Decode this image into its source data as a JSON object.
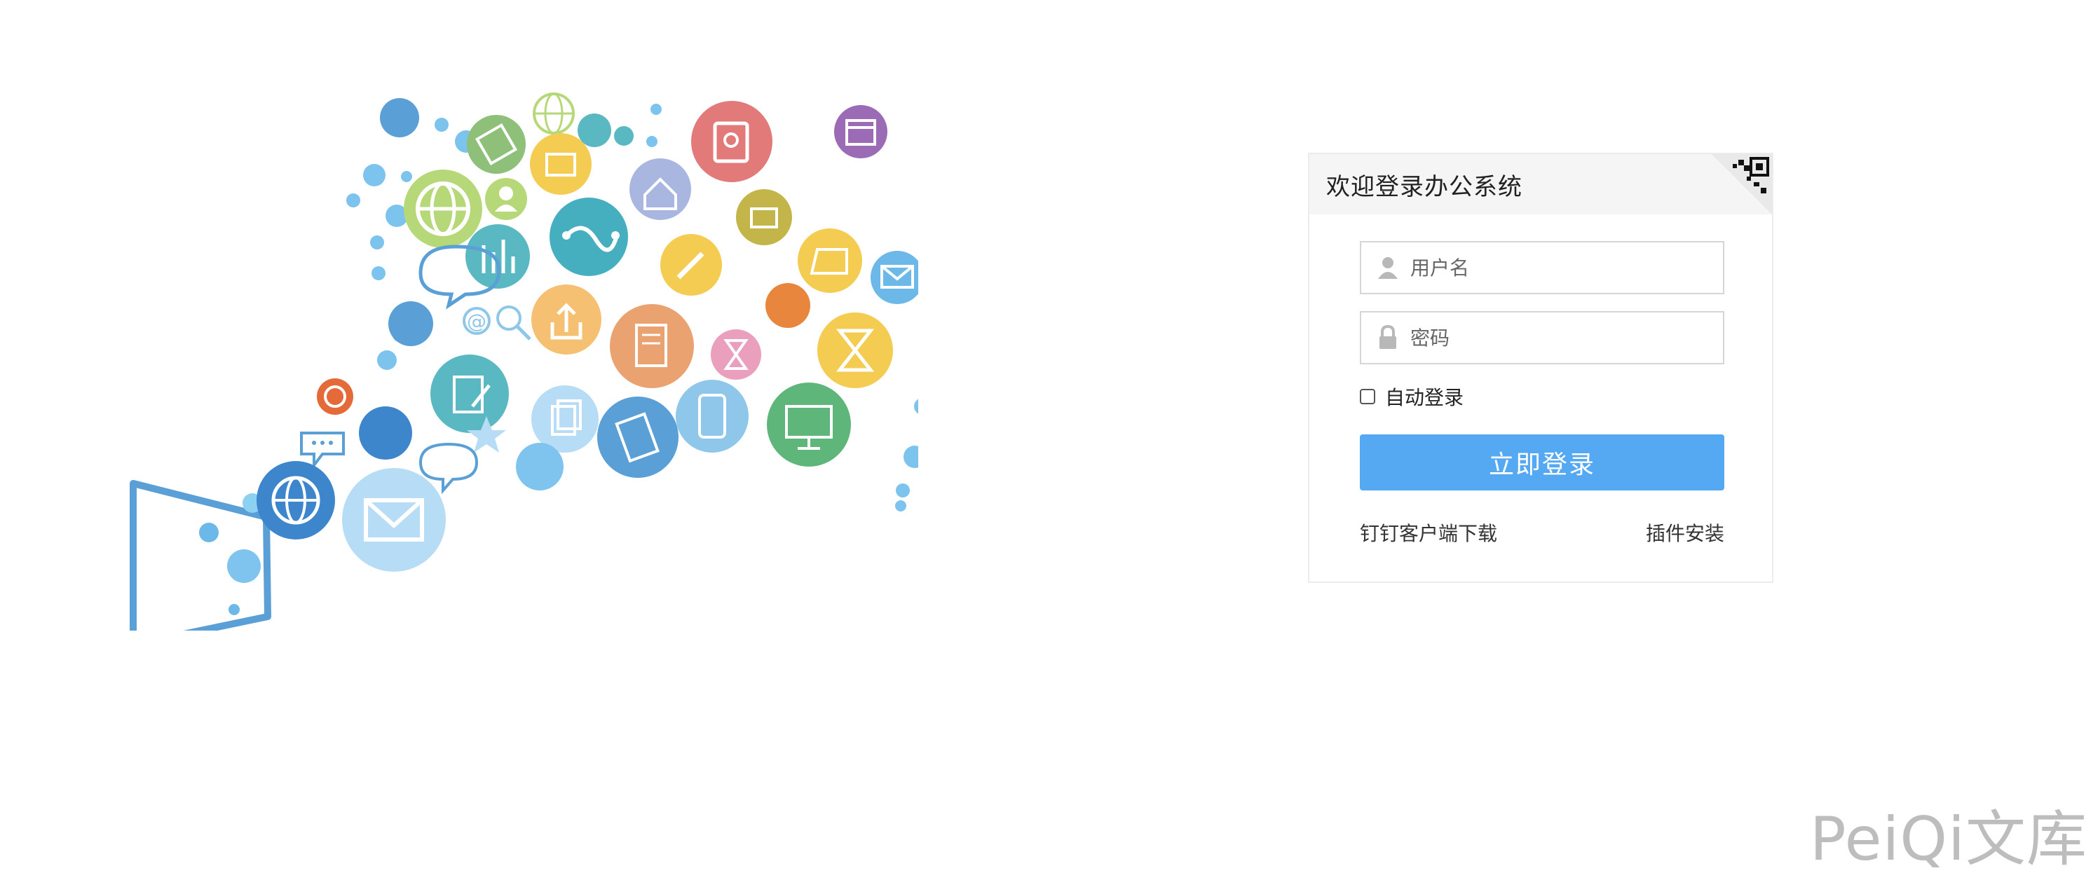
{
  "login": {
    "title": "欢迎登录办公系统",
    "qr_icon": "qr-code-icon",
    "username_placeholder": "用户名",
    "username_icon": "user-icon",
    "password_placeholder": "密码",
    "password_icon": "lock-icon",
    "remember_label": "自动登录",
    "submit_label": "立即登录",
    "link_dingtalk": "钉钉客户端下载",
    "link_plugin": "插件安装"
  },
  "watermark": "PeiQi文库",
  "colors": {
    "accent": "#55a9f3",
    "panel_header_bg": "#f5f5f5",
    "watermark": "#bdbdbd"
  },
  "illustration": {
    "icons": [
      "globe-icon",
      "user-icon",
      "chart-icon",
      "folder-icon",
      "home-icon",
      "contacts-icon",
      "calendar-icon",
      "upload-icon",
      "document-icon",
      "hourglass-icon",
      "mail-icon",
      "wifi-icon",
      "mobile-icon",
      "chat-icon",
      "pencil-icon",
      "search-icon",
      "at-icon",
      "star-icon",
      "monitor-icon"
    ]
  }
}
